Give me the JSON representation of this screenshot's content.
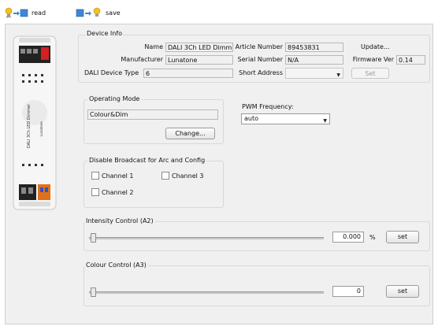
{
  "toolbar": {
    "read_label": "read",
    "save_label": "save"
  },
  "device_info": {
    "title": "Device Info",
    "name_label": "Name",
    "name_value": "DALI 3Ch LED Dimm...",
    "article_label": "Article Number",
    "article_value": "89453831",
    "update_label": "Update...",
    "manufacturer_label": "Manufacturer",
    "manufacturer_value": "Lunatone",
    "serial_label": "Serial Number",
    "serial_value": "N/A",
    "firmware_label": "Firmware Ver",
    "firmware_value": "0.14",
    "type_label": "DALI Device Type",
    "type_value": "6",
    "short_label": "Short Address",
    "short_value": "",
    "set_label": "Set"
  },
  "operating_mode": {
    "title": "Operating Mode",
    "value": "Colour&Dim",
    "change_label": "Change..."
  },
  "pwm": {
    "label": "PWM Frequency:",
    "value": "auto"
  },
  "broadcast": {
    "title": "Disable Broadcast  for Arc and Config",
    "channel1": "Channel 1",
    "channel2": "Channel 2",
    "channel3": "Channel 3"
  },
  "intensity": {
    "title": "Intensity Control (A2)",
    "value": "0.000",
    "unit": "%",
    "set_label": "set",
    "level": 0
  },
  "colour": {
    "title": "Colour Control (A3)",
    "value": "0",
    "set_label": "set",
    "level": 0
  },
  "device_image": {
    "brand_text": "Lunatone",
    "product_text": "DALI 3Ch LED Dimmer"
  },
  "colors": {
    "panel_bg": "#f0f0f0",
    "border": "#cfcfcf"
  }
}
